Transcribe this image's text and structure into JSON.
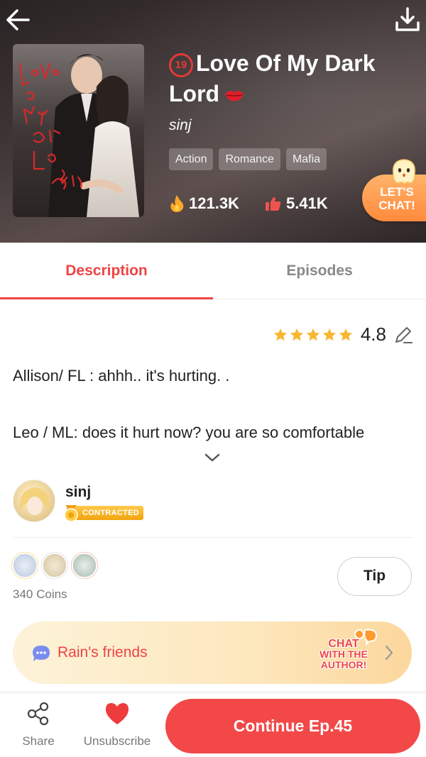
{
  "header": {
    "title": "Love Of My Dark Lord",
    "age_rating": "19",
    "author": "sinj",
    "tags": [
      "Action",
      "Romance",
      "Mafia"
    ],
    "views": "121.3K",
    "likes": "5.41K",
    "lets_chat": [
      "LET'S",
      "CHAT!"
    ],
    "cover_script_text": [
      "Love",
      "of",
      "My",
      "Dark",
      "Lord",
      "Rain"
    ]
  },
  "tabs": [
    {
      "label": "Description",
      "active": true
    },
    {
      "label": "Episodes",
      "active": false
    }
  ],
  "rating": {
    "value": "4.8",
    "stars": 5
  },
  "description": {
    "lines": [
      "Allison/ FL : ahhh.. it's  hurting. .",
      "Leo / ML: does it hurt now? you are so comfortable"
    ]
  },
  "author_section": {
    "name": "sinj",
    "badge": "CONTRACTED"
  },
  "support": {
    "coins": "340 Coins",
    "tip_label": "Tip",
    "supporter_count": 3
  },
  "friends_banner": {
    "label": "Rain's friends",
    "chat_author": [
      "CHAT",
      "WITH THE",
      "AUTHOR!"
    ]
  },
  "bottom_bar": {
    "share": "Share",
    "unsubscribe": "Unsubscribe",
    "continue": "Continue Ep.45"
  },
  "colors": {
    "accent": "#ee4444",
    "orange": "#ff8a3d",
    "star": "#f7b731"
  }
}
